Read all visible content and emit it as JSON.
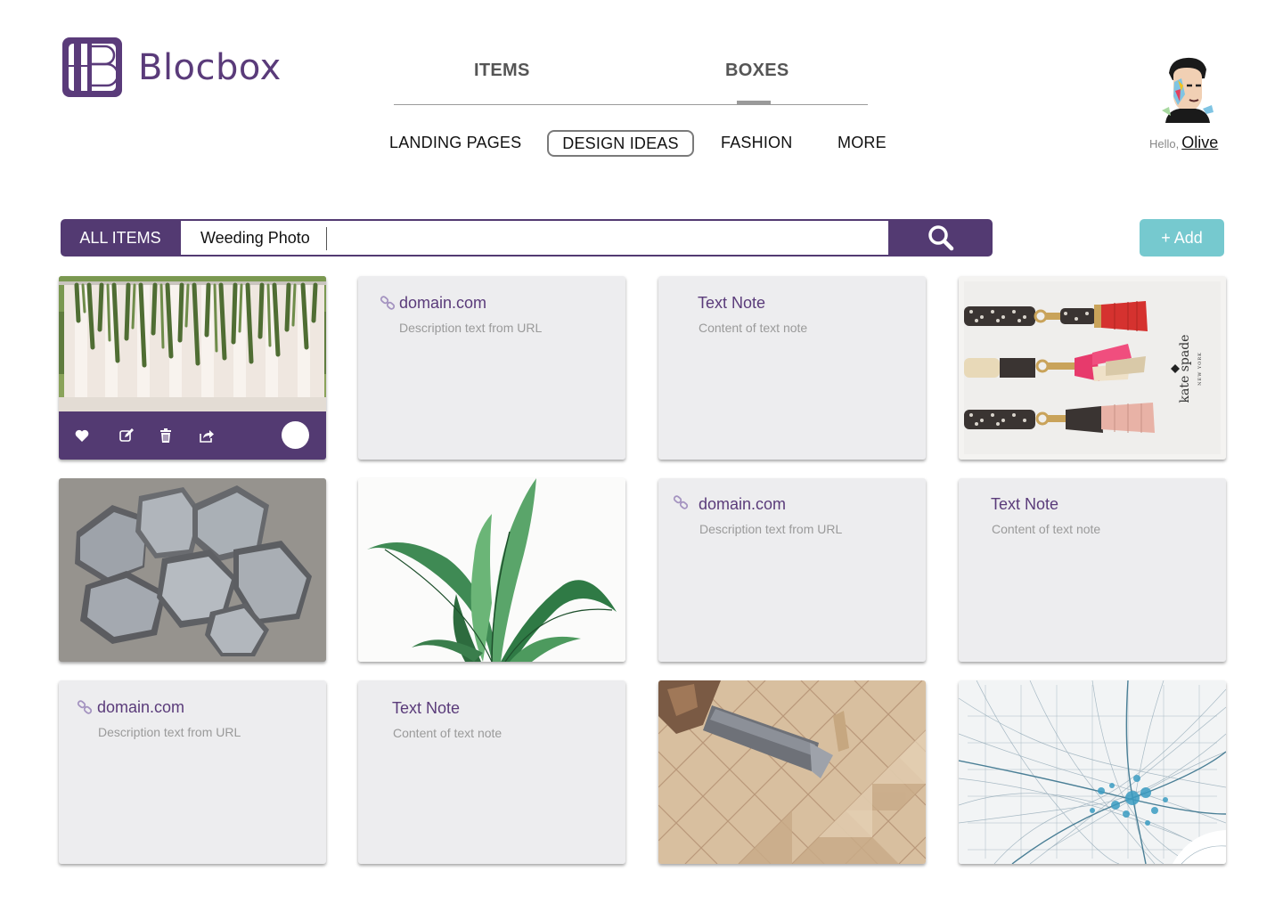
{
  "app": {
    "name": "Blocbox"
  },
  "nav": {
    "primary": [
      {
        "label": "ITEMS"
      },
      {
        "label": "BOXES"
      }
    ],
    "secondary": [
      {
        "label": "LANDING PAGES"
      },
      {
        "label": "DESIGN IDEAS"
      },
      {
        "label": "FASHION"
      },
      {
        "label": "MORE"
      }
    ]
  },
  "user": {
    "greeting": "Hello,",
    "name": "Olive"
  },
  "search": {
    "filter_label": "ALL ITEMS",
    "value": "Weeding Photo"
  },
  "add_button": {
    "label": "+ Add"
  },
  "cards": {
    "link1": {
      "title": "domain.com",
      "desc": "Description text from URL"
    },
    "note1": {
      "title": "Text Note",
      "desc": "Content of text note"
    },
    "link2": {
      "title": "domain.com",
      "desc": "Description text from URL"
    },
    "note2": {
      "title": "Text Note",
      "desc": "Content of text note"
    },
    "link3": {
      "title": "domain.com",
      "desc": "Description text from URL"
    },
    "note3": {
      "title": "Text Note",
      "desc": "Content of text note"
    }
  },
  "kate_spade_text": {
    "brand": "kate spade",
    "city": "NEW YORK"
  },
  "colors": {
    "brand_purple": "#533a72",
    "add_teal": "#76c9cf",
    "card_bg": "#ededef"
  }
}
